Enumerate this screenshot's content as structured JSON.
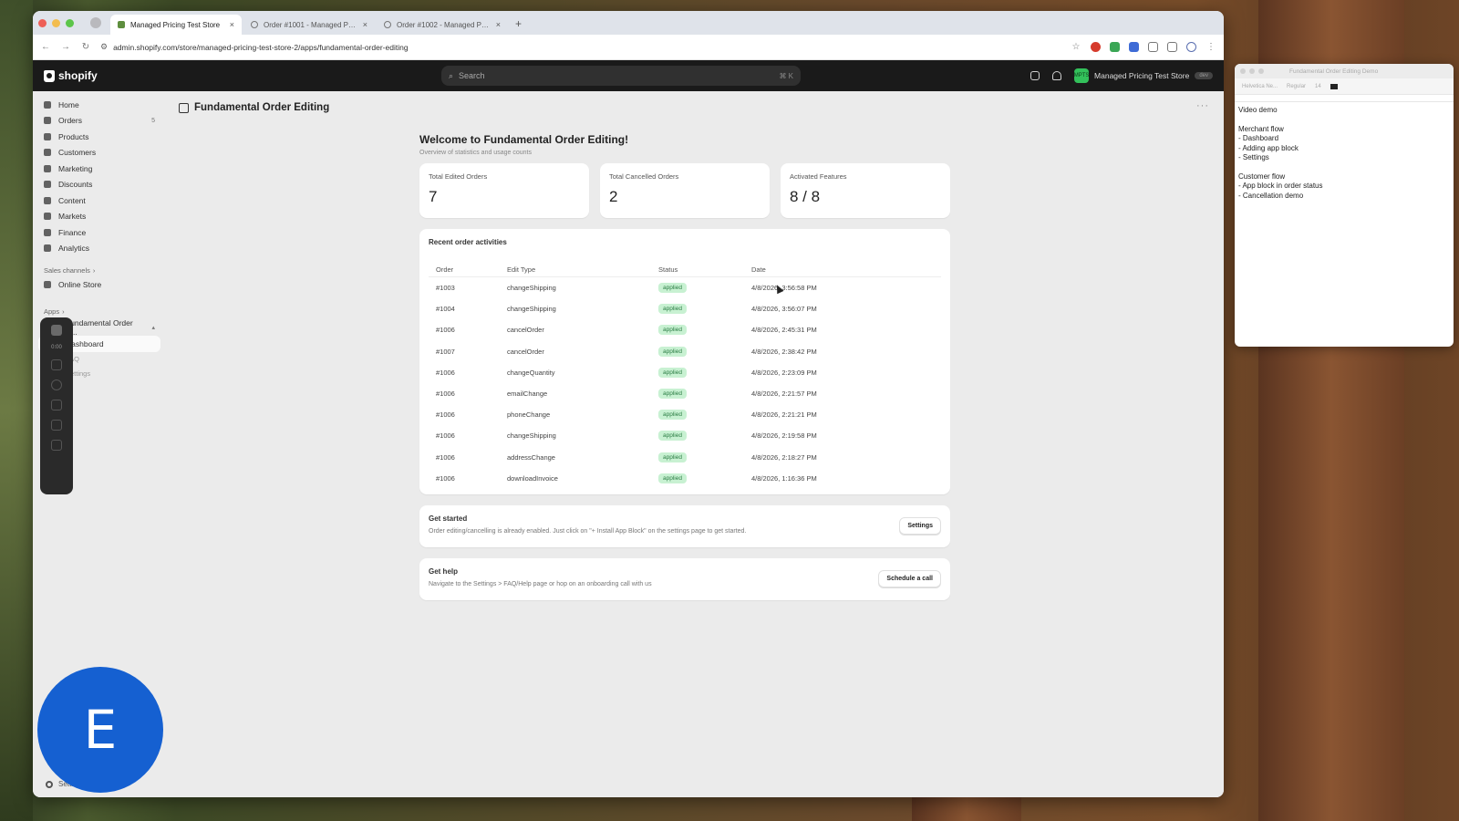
{
  "browser": {
    "tabs": [
      {
        "label": "Managed Pricing Test Store",
        "active": true
      },
      {
        "label": "Order #1001 - Managed Pri...",
        "active": false
      },
      {
        "label": "Order #1002 - Managed Pri...",
        "active": false
      }
    ],
    "url": "admin.shopify.com/store/managed-pricing-test-store-2/apps/fundamental-order-editing"
  },
  "topbar": {
    "logo": "shopify",
    "search_placeholder": "Search",
    "search_shortcut": "⌘ K",
    "store_initials": "MPTS",
    "store_name": "Managed Pricing Test Store",
    "store_badge": "dev"
  },
  "sidebar": {
    "items": [
      {
        "label": "Home"
      },
      {
        "label": "Orders",
        "count": "5"
      },
      {
        "label": "Products"
      },
      {
        "label": "Customers"
      },
      {
        "label": "Marketing"
      },
      {
        "label": "Discounts"
      },
      {
        "label": "Content"
      },
      {
        "label": "Markets"
      },
      {
        "label": "Finance"
      },
      {
        "label": "Analytics"
      }
    ],
    "sales_channels_label": "Sales channels",
    "sales_channels": [
      {
        "label": "Online Store"
      }
    ],
    "apps_label": "Apps",
    "app_name": "Fundamental Order E...",
    "app_subitems": [
      "Dashboard",
      "FAQ",
      "Settings"
    ],
    "settings_label": "Settings"
  },
  "recorder": {
    "time": "0:00"
  },
  "page": {
    "title": "Fundamental Order Editing",
    "welcome_title": "Welcome to Fundamental Order Editing!",
    "welcome_sub": "Overview of statistics and usage counts"
  },
  "stats": [
    {
      "label": "Total Edited Orders",
      "value": "7"
    },
    {
      "label": "Total Cancelled Orders",
      "value": "2"
    },
    {
      "label": "Activated Features",
      "value": "8 / 8"
    }
  ],
  "activities": {
    "title": "Recent order activities",
    "columns": [
      "Order",
      "Edit Type",
      "Status",
      "Date"
    ],
    "rows": [
      {
        "order": "#1003",
        "type": "changeShipping",
        "status": "applied",
        "date": "4/8/2026, 3:56:58 PM"
      },
      {
        "order": "#1004",
        "type": "changeShipping",
        "status": "applied",
        "date": "4/8/2026, 3:56:07 PM"
      },
      {
        "order": "#1006",
        "type": "cancelOrder",
        "status": "applied",
        "date": "4/8/2026, 2:45:31 PM"
      },
      {
        "order": "#1007",
        "type": "cancelOrder",
        "status": "applied",
        "date": "4/8/2026, 2:38:42 PM"
      },
      {
        "order": "#1006",
        "type": "changeQuantity",
        "status": "applied",
        "date": "4/8/2026, 2:23:09 PM"
      },
      {
        "order": "#1006",
        "type": "emailChange",
        "status": "applied",
        "date": "4/8/2026, 2:21:57 PM"
      },
      {
        "order": "#1006",
        "type": "phoneChange",
        "status": "applied",
        "date": "4/8/2026, 2:21:21 PM"
      },
      {
        "order": "#1006",
        "type": "changeShipping",
        "status": "applied",
        "date": "4/8/2026, 2:19:58 PM"
      },
      {
        "order": "#1006",
        "type": "addressChange",
        "status": "applied",
        "date": "4/8/2026, 2:18:27 PM"
      },
      {
        "order": "#1006",
        "type": "downloadInvoice",
        "status": "applied",
        "date": "4/8/2026, 1:16:36 PM"
      }
    ]
  },
  "get_started": {
    "title": "Get started",
    "desc": "Order editing/cancelling is already enabled. Just click on \"+ Install App Block\" on the settings page to get started.",
    "button": "Settings"
  },
  "get_help": {
    "title": "Get help",
    "desc": "Navigate to the Settings > FAQ/Help page or hop on an onboarding call with us",
    "button": "Schedule a call"
  },
  "notes": {
    "title": "Fundamental Order Editing Demo",
    "font_size": "14",
    "lines": [
      "Video demo",
      "",
      "Merchant flow",
      "- Dashboard",
      "- Adding app block",
      "- Settings",
      "",
      "Customer flow",
      "- App block in order status",
      "- Cancellation demo"
    ]
  },
  "cam": {
    "initial": "E",
    "color": "#1560d1"
  },
  "colors": {
    "status_bg": "#c8f1d2",
    "status_text": "#2a7c43",
    "topbar": "#1a1a1a"
  }
}
